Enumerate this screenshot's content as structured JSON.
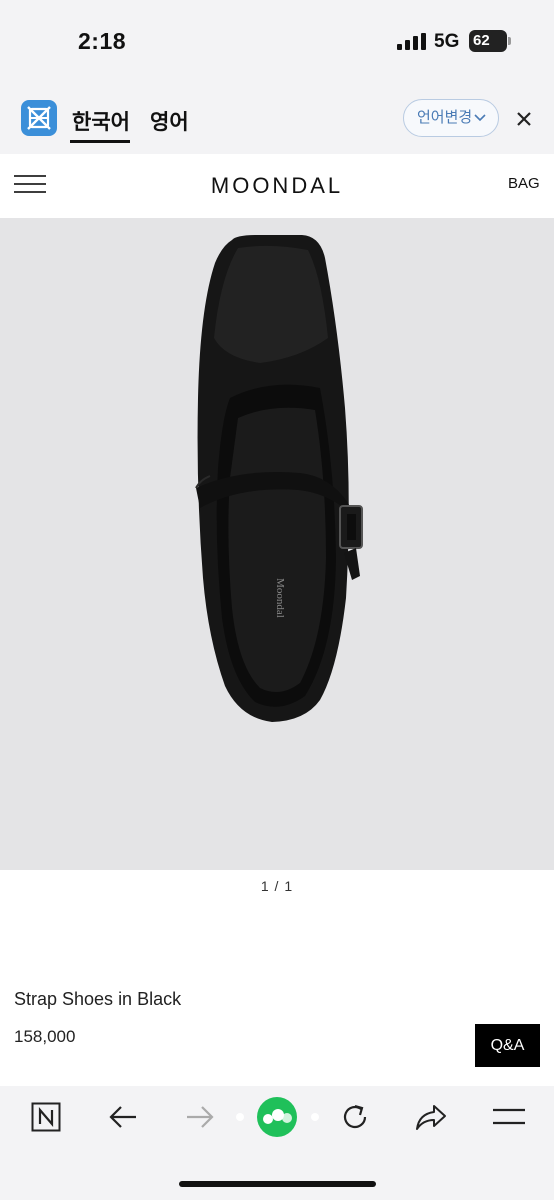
{
  "status_bar": {
    "time": "2:18",
    "network": "5G",
    "battery": "62"
  },
  "translate_bar": {
    "active_language": "한국어",
    "target_language": "영어",
    "change_button": "언어변경",
    "close_icon": "close-icon"
  },
  "header": {
    "brand": "MOONDAL",
    "bag_label": "BAG",
    "menu_icon": "hamburger-icon"
  },
  "product": {
    "image_counter": "1 / 1",
    "name": "Strap Shoes in Black",
    "price": "158,000",
    "qa_label": "Q&A",
    "insole_text": "Moondal"
  },
  "browser_bar": {
    "icons": [
      "naver-n-icon",
      "back-arrow-icon",
      "forward-arrow-icon",
      "green-dot-icon",
      "reload-icon",
      "share-icon",
      "menu-icon"
    ]
  }
}
